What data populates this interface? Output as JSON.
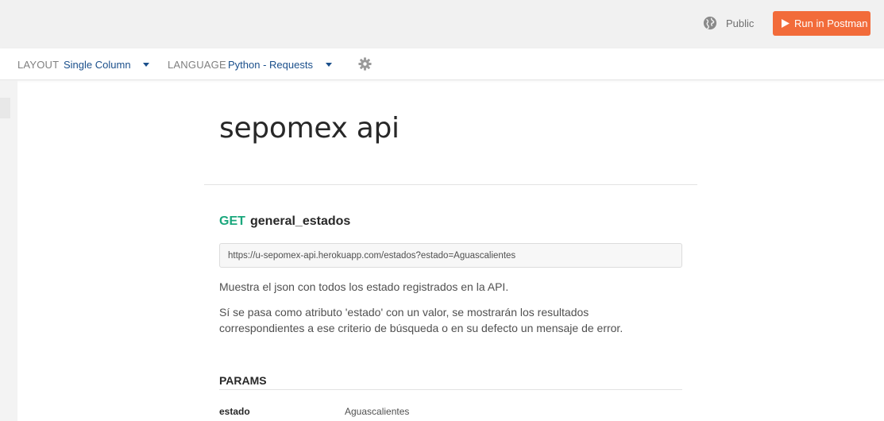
{
  "header": {
    "visibility_label": "Public",
    "visibility_icon": "globe-icon",
    "run_button_label": "Run in Postman",
    "run_button_icon": "play-icon",
    "accent_color": "#f26b3a"
  },
  "toolbar": {
    "layout_label": "LAYOUT",
    "layout_value": "Single Column",
    "language_label": "LANGUAGE",
    "language_value": "Python - Requests",
    "settings_icon": "gear-icon"
  },
  "doc": {
    "title": "sepomex api",
    "request": {
      "method": "GET",
      "method_color": "#1aa77c",
      "name": "general_estados",
      "url": "https://u-sepomex-api.herokuapp.com/estados?estado=Aguascalientes",
      "description": [
        "Muestra el json con todos los estado registrados en la API.",
        "Sí se pasa como atributo 'estado' con un valor, se mostrarán los resultados correspondientes a ese criterio de búsqueda o en su defecto un mensaje de error."
      ],
      "params_title": "PARAMS",
      "params": [
        {
          "key": "estado",
          "value": "Aguascalientes"
        }
      ]
    }
  }
}
